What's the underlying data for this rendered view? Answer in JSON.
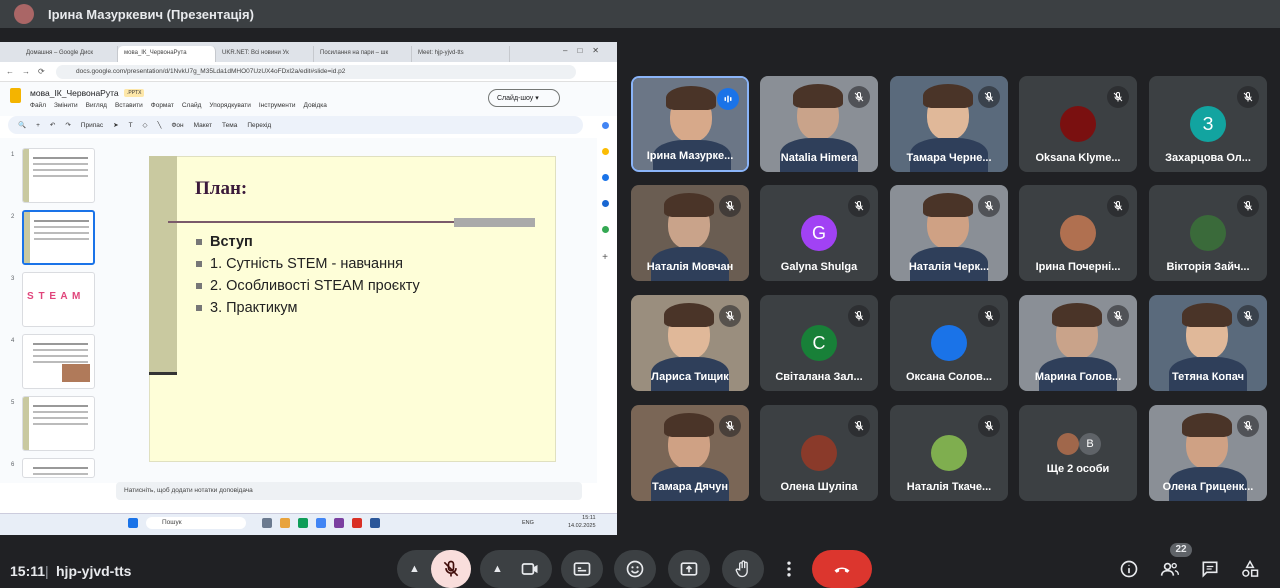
{
  "presenter_bar": {
    "title": "Ірина Мазуркевич (Презентація)"
  },
  "browser": {
    "tabs": [
      "Домашня – Google Диск",
      "мова_ІК_ЧервонаРута",
      "UKR.NET: Всі новини Ук",
      "Посилання на пари – шк",
      "Meet: hjp-yjvd-tts"
    ],
    "url": "docs.google.com/presentation/d/1NvkU7g_M35Lda1dMHO07UzUX4oFDxl2a/edit#slide=id.p2"
  },
  "slides_app": {
    "doc_title": "мова_ІК_ЧервонаРута",
    "badge": ".PPTX",
    "menus": [
      "Файл",
      "Змінити",
      "Вигляд",
      "Вставити",
      "Формат",
      "Слайд",
      "Упорядкувати",
      "Інструменти",
      "Довідка"
    ],
    "slideshow_label": "Слайд-шоу",
    "toolbar": [
      "Припас",
      "Фон",
      "Макет",
      "Тема",
      "Перехід"
    ],
    "thumbnail_numbers": [
      "1",
      "2",
      "3",
      "4",
      "5",
      "6"
    ],
    "thumbnail_titles": [
      "Застосування STEAM технологій",
      "План",
      "STEAM освіта",
      "STEM як технологія навчання",
      "STEAM",
      ""
    ],
    "steam_word": "S T E A M",
    "notes_placeholder": "Натисніть, щоб додати нотатки доповідача"
  },
  "current_slide": {
    "title": "План:",
    "items": [
      "Вступ",
      "1. Сутність STEM - навчання",
      "2. Особливості STEAM проєкту",
      "3. Практикум"
    ]
  },
  "taskbar": {
    "search": "Пошук",
    "lang": "ENG",
    "time": "15:11",
    "date": "14.02.2025"
  },
  "participants": [
    {
      "name": "Ірина Мазурке...",
      "type": "photo",
      "speaking": true
    },
    {
      "name": "Natalia Himera",
      "type": "photo"
    },
    {
      "name": "Тамара Черне...",
      "type": "photo"
    },
    {
      "name": "Oksana Klyme...",
      "type": "avatar",
      "color": "#7a1010",
      "letter": ""
    },
    {
      "name": "Захарцова Ол...",
      "type": "avatar",
      "color": "#12a4a0",
      "letter": "З"
    },
    {
      "name": "Наталія Мовчан",
      "type": "photo"
    },
    {
      "name": "Galyna Shulga",
      "type": "avatar",
      "color": "#a142f4",
      "letter": "G"
    },
    {
      "name": "Наталія Черк...",
      "type": "photo"
    },
    {
      "name": "Ірина Почерні...",
      "type": "avatar",
      "color": "#b07050",
      "letter": ""
    },
    {
      "name": "Вікторія Зайч...",
      "type": "avatar",
      "color": "#3a6a3a",
      "letter": ""
    },
    {
      "name": "Лариса Тищик",
      "type": "photo"
    },
    {
      "name": "Світалана Зал...",
      "type": "avatar",
      "color": "#188038",
      "letter": "C"
    },
    {
      "name": "Оксана Солов...",
      "type": "avatar",
      "color": "#1a73e8",
      "letter": ""
    },
    {
      "name": "Марина Голов...",
      "type": "photo"
    },
    {
      "name": "Тетяна Копач",
      "type": "photo"
    },
    {
      "name": "Тамара Дячун",
      "type": "photo"
    },
    {
      "name": "Олена Шуліпа",
      "type": "avatar",
      "color": "#8a3a2a",
      "letter": ""
    },
    {
      "name": "Наталія Ткаче...",
      "type": "avatar",
      "color": "#7fae4f",
      "letter": ""
    },
    {
      "name": "Ще 2 особи",
      "type": "more",
      "letter": "B"
    },
    {
      "name": "Олена Гриценк...",
      "type": "photo"
    }
  ],
  "meeting": {
    "time": "15:11",
    "code": "hjp-yjvd-tts",
    "people_count": "22"
  }
}
